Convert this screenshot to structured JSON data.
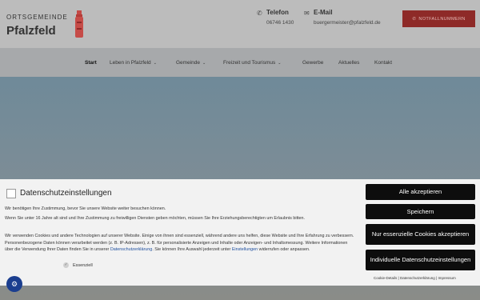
{
  "header": {
    "logo_small": "ORTSGEMEINDE",
    "logo_big": "Pfalzfeld",
    "phone_label": "Telefon",
    "phone_value": "06746 1430",
    "email_label": "E-Mail",
    "email_value": "buergermeister@pfalzfeld.de",
    "emergency_label": "NOTFALLNUMMERN"
  },
  "nav": {
    "items": [
      {
        "label": "Start"
      },
      {
        "label": "Leben in Pfalzfeld"
      },
      {
        "label": "Gemeinde"
      },
      {
        "label": "Freizeit und Tourismus"
      },
      {
        "label": "Gewerbe"
      },
      {
        "label": "Aktuelles"
      },
      {
        "label": "Kontakt"
      }
    ]
  },
  "dialog": {
    "title": "Datenschutzeinstellungen",
    "p1": "Wir benötigen Ihre Zustimmung, bevor Sie unsere Website weiter besuchen können.",
    "p2": "Wenn Sie unter 16 Jahre alt sind und Ihre Zustimmung zu freiwilligen Diensten geben möchten, müssen Sie Ihre Erziehungsberechtigten um Erlaubnis bitten.",
    "p3_a": "Wir verwenden Cookies und andere Technologien auf unserer Website. Einige von ihnen sind essenziell, während andere uns helfen, diese Website und Ihre Erfahrung zu verbessern. Personenbezogene Daten können verarbeitet werden (z. B. IP-Adressen), z. B. für personalisierte Anzeigen und Inhalte oder Anzeigen- und Inhaltsmessung. Weitere Informationen über die Verwendung Ihrer Daten finden Sie in unserer ",
    "p3_link": "Datenschutzerklärung",
    "p3_b": ". Sie können Ihre Auswahl jederzeit unter ",
    "p3_link2": "Einstellungen",
    "p3_c": " widerrufen oder anpassen.",
    "essential_label": "Essenziell",
    "btn_accept_all": "Alle akzeptieren",
    "btn_save": "Speichern",
    "btn_essential_only": "Nur essenzielle Cookies akzeptieren",
    "btn_individual": "Individuelle Datenschutzeinstellungen",
    "footer_cookie": "Cookie-Details",
    "footer_privacy": "Datenschutzerklärung",
    "footer_imprint": "Impressum",
    "footer_sep": "|"
  },
  "colors": {
    "emergency_bg": "#8e2a28",
    "dialog_button": "#0d0d0d",
    "link": "#1d4e9e",
    "badge": "#1b3e8f"
  },
  "icons": {
    "phone": "phone-icon",
    "email": "envelope-icon",
    "emergency": "phone-icon",
    "badge": "cookie-settings-icon"
  }
}
